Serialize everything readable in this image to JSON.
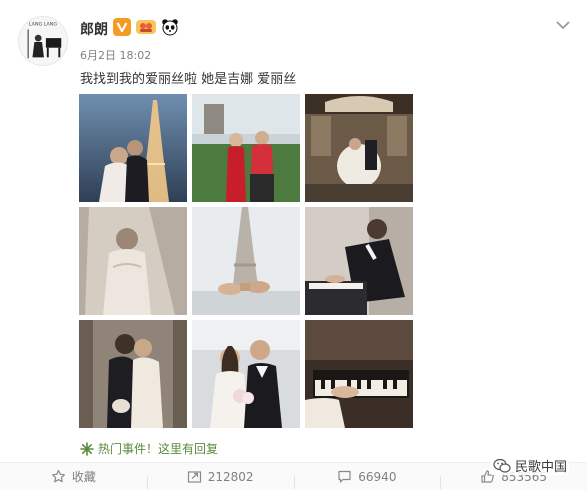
{
  "post": {
    "username": "郎朗",
    "timestamp": "6月2日 18:02",
    "text": "我找到我的爱丽丝啦 她是吉娜 爱丽丝",
    "hot_event": "热门事件！这里有回复",
    "avatar_caption": "LANG LANG"
  },
  "photos": [
    {
      "name": "eiffel-tower-night-couple"
    },
    {
      "name": "couple-in-red-qipao"
    },
    {
      "name": "cafe-wedding-scene"
    },
    {
      "name": "bride-with-veil"
    },
    {
      "name": "eiffel-tower-hands"
    },
    {
      "name": "groom-at-piano"
    },
    {
      "name": "couple-embracing-doorway"
    },
    {
      "name": "couple-smiling-bouquet"
    },
    {
      "name": "hands-on-piano-keys"
    }
  ],
  "footer": {
    "favorite_label": "收藏",
    "repost_count": "212802",
    "comment_count": "66940",
    "like_count": "853565"
  },
  "watermark": {
    "text": "民歌中国"
  },
  "colors": {
    "link_green": "#5a8a3c",
    "verified_orange": "#f59a23",
    "muted_gray": "#808080"
  },
  "icons": [
    "caret-down-icon",
    "verified-v-icon",
    "group-badge-icon",
    "panda-icon",
    "hot-event-icon",
    "favorite-icon",
    "repost-icon",
    "comment-icon",
    "like-icon",
    "wechat-icon"
  ]
}
